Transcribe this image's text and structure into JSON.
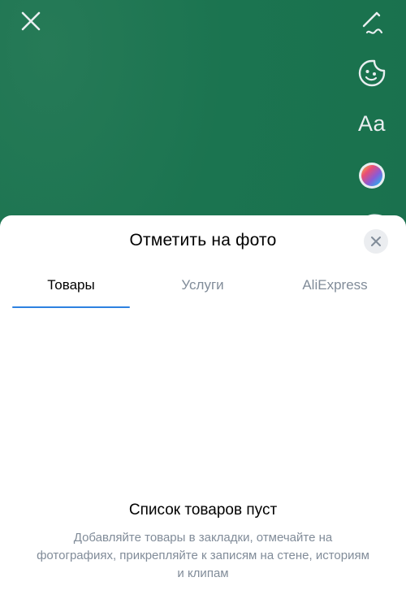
{
  "canvas": {
    "background_color": "#1b7450"
  },
  "toolbar": {
    "close_icon": "close-icon",
    "tools": [
      {
        "name": "draw-icon"
      },
      {
        "name": "sticker-icon"
      },
      {
        "name": "text-tool",
        "label": "Aa"
      },
      {
        "name": "color-picker-icon"
      }
    ]
  },
  "sheet": {
    "title": "Отметить на фото",
    "close_icon": "close-icon",
    "tabs": [
      {
        "label": "Товары",
        "active": true
      },
      {
        "label": "Услуги",
        "active": false
      },
      {
        "label": "AliExpress",
        "active": false
      }
    ],
    "accent_color": "#2d81e0",
    "empty_state": {
      "title": "Список товаров пуст",
      "description": "Добавляйте товары в закладки, отмечайте на фотографиях, прикрепляйте к записям на стене, историям и клипам"
    }
  }
}
